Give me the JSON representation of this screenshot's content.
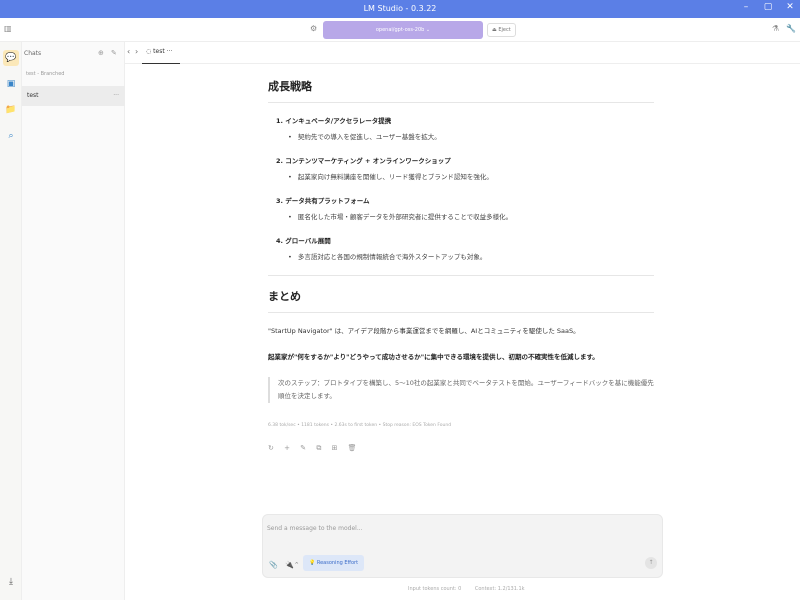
{
  "window": {
    "title": "LM Studio - 0.3.22"
  },
  "toolbar": {
    "model": "openai/gpt-oss-20b",
    "eject_label": "Eject"
  },
  "sidebar": {
    "header": "Chats",
    "branch_label": "test - Branched",
    "chat_item": "test",
    "chat_dots": "···"
  },
  "tab": {
    "label": "test"
  },
  "content": {
    "h_strategy": "成長戦略",
    "items": [
      {
        "title": "1. インキュベータ/アクセラレータ提携",
        "sub": "契約先での導入を促進し、ユーザー基盤を拡大。"
      },
      {
        "title": "2. コンテンツマーケティング + オンラインワークショップ",
        "sub": "起業家向け無料講座を開催し、リード獲得とブランド認知を強化。"
      },
      {
        "title": "3. データ共有プラットフォーム",
        "sub": "匿名化した市場・顧客データを外部研究者に提供することで収益多様化。"
      },
      {
        "title": "4. グローバル展開",
        "sub": "多言語対応と各国の規制情報統合で海外スタートアップも対象。"
      }
    ],
    "h_summary": "まとめ",
    "p1": "\"StartUp Navigator\" は、アイデア段階から事業運営までを網羅し、AIとコミュニティを駆使した SaaS。",
    "p2": "起業家が\"何をするか\"より\"どうやって成功させるか\"に集中できる環境を提供し、初期の不確実性を低減します。",
    "quote": "次のステップ：プロトタイプを構築し、5～10社の起業家と共同でベータテストを開始。ユーザーフィードバックを基に機能優先順位を決定します。",
    "stats": "6.38 tok/sec • 1181 tokens • 2.63s to first token • Stop reason: EOS Token Found",
    "actions": "↻ + ✎ ⧉ ⊞ 🗑"
  },
  "composer": {
    "placeholder": "Send a message to the model...",
    "reasoning_label": "Reasoning Effort"
  },
  "footer": {
    "input_tokens": "Input tokens count: 0",
    "context": "Context: 1.2/131.1k"
  }
}
